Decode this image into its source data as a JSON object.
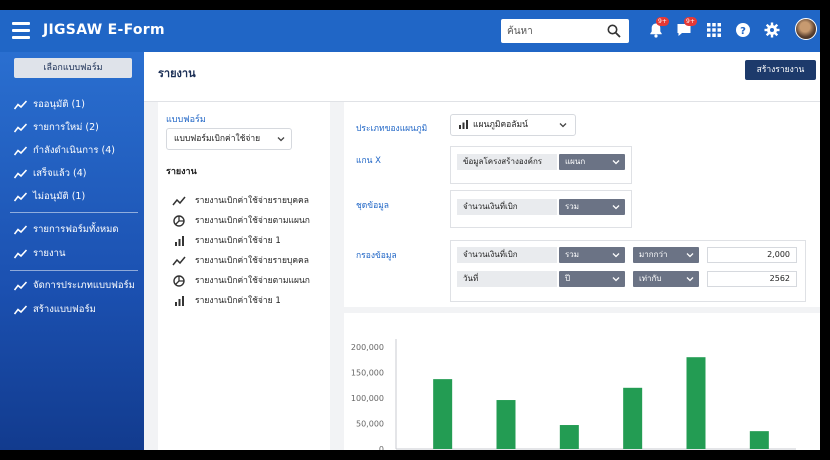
{
  "app": {
    "title": "JIGSAW E-Form"
  },
  "search": {
    "placeholder": "ค้นหา"
  },
  "header": {
    "notifications_badge": "9+",
    "messages_badge": "9+"
  },
  "sidebar": {
    "select_form_button": "เลือกแบบฟอร์ม",
    "items": [
      {
        "label": "รออนุมัติ (1)"
      },
      {
        "label": "รายการใหม่ (2)"
      },
      {
        "label": "กำลังดำเนินการ (4)"
      },
      {
        "label": "เสร็จแล้ว (4)"
      },
      {
        "label": "ไม่อนุมัติ (1)"
      },
      {
        "label": "รายการฟอร์มทั้งหมด"
      },
      {
        "label": "รายงาน"
      },
      {
        "label": "จัดการประเภทแบบฟอร์ม"
      },
      {
        "label": "สร้างแบบฟอร์ม"
      }
    ]
  },
  "page": {
    "title": "รายงาน",
    "create_report_button": "สร้างรายงาน"
  },
  "report_panel": {
    "form_label": "แบบฟอร์ม",
    "form_select_value": "แบบฟอร์มเบิกค่าใช้จ่าย",
    "reports_heading": "รายงาน",
    "reports": [
      {
        "label": "รายงานเบิกค่าใช้จ่ายรายบุคคล",
        "icon": "line-chart-icon"
      },
      {
        "label": "รายงานเบิกค่าใช้จ่ายตามแผนก",
        "icon": "pie-chart-icon"
      },
      {
        "label": "รายงานเบิกค่าใช้จ่าย 1",
        "icon": "bar-chart-icon"
      },
      {
        "label": "รายงานเบิกค่าใช้จ่ายรายบุคคล",
        "icon": "line-chart-icon"
      },
      {
        "label": "รายงานเบิกค่าใช้จ่ายตามแผนก",
        "icon": "pie-chart-icon"
      },
      {
        "label": "รายงานเบิกค่าใช้จ่าย 1",
        "icon": "bar-chart-icon"
      }
    ]
  },
  "filters": {
    "chart_type_label": "ประเภทของแผนภูมิ",
    "chart_type_value": "แผนภูมิคอลัมน์",
    "x_axis_label": "แกน X",
    "x_axis_field": "ข้อมูลโครงสร้างองค์กร",
    "x_axis_value": "แผนก",
    "dataset_label": "ชุดข้อมูล",
    "dataset_field": "จำนวนเงินที่เบิก",
    "dataset_agg": "รวม",
    "filter_label": "กรองข้อมูล",
    "rows": [
      {
        "field": "จำนวนเงินที่เบิก",
        "agg": "รวม",
        "op": "มากกว่า",
        "value": "2,000"
      },
      {
        "field": "วันที่",
        "agg": "ปี",
        "op": "เท่ากับ",
        "value": "2562"
      }
    ]
  },
  "chart_data": {
    "type": "bar",
    "title": "",
    "xlabel": "",
    "ylabel": "",
    "ylim": [
      0,
      200000
    ],
    "y_ticks": [
      "200,000",
      "150,000",
      "100,000",
      "50,000",
      "0"
    ],
    "values": [
      137000,
      96000,
      47000,
      120000,
      180000,
      35000
    ],
    "color": "#239c53",
    "grid": false
  }
}
